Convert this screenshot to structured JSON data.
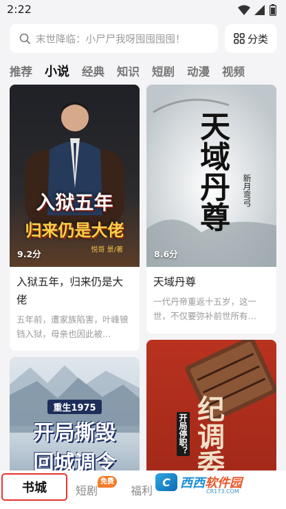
{
  "status_bar": {
    "time": "2:22"
  },
  "search": {
    "placeholder": "末世降临：小尸尸我呀囤囤囤囤！"
  },
  "category_button": {
    "label": "分类"
  },
  "tabs": [
    {
      "label": "推荐"
    },
    {
      "label": "小说",
      "active": true
    },
    {
      "label": "经典"
    },
    {
      "label": "知识"
    },
    {
      "label": "短剧"
    },
    {
      "label": "动漫"
    },
    {
      "label": "视频"
    }
  ],
  "books": [
    {
      "title": "入狱五年，归来仍是大佬",
      "rating": "9.2分",
      "description": "五年前，遭家族陷害，叶峰锒铛入狱，母亲也因此被…",
      "cover_text": {
        "line1": "入狱五年",
        "line2": "归来仍是大佬",
        "author": "悦哥 景/著"
      }
    },
    {
      "title": "天域丹尊",
      "rating": "8.6分",
      "description": "一代丹帝重返十五岁，这一世，不仅要弥补前世所有…",
      "cover_text": {
        "line1": "天域",
        "line2": "丹尊",
        "author": "新月弯弓"
      }
    },
    {
      "cover_text": {
        "line1": "重生1975",
        "line2": "开局撕毁",
        "line3": "回城调令"
      }
    },
    {
      "cover_text": {
        "line1": "纪调委",
        "side": "开局停职？"
      }
    }
  ],
  "bottom_nav": {
    "items": [
      {
        "label": "书城",
        "active": true
      },
      {
        "label": "短剧",
        "badge": "免费"
      },
      {
        "label": "福利"
      }
    ]
  },
  "watermark": {
    "text_a": "西西",
    "text_b": "软件园",
    "sub": "CR173.COM"
  },
  "colors": {
    "accent": "#e3342f",
    "badge": "#f07d2b"
  }
}
